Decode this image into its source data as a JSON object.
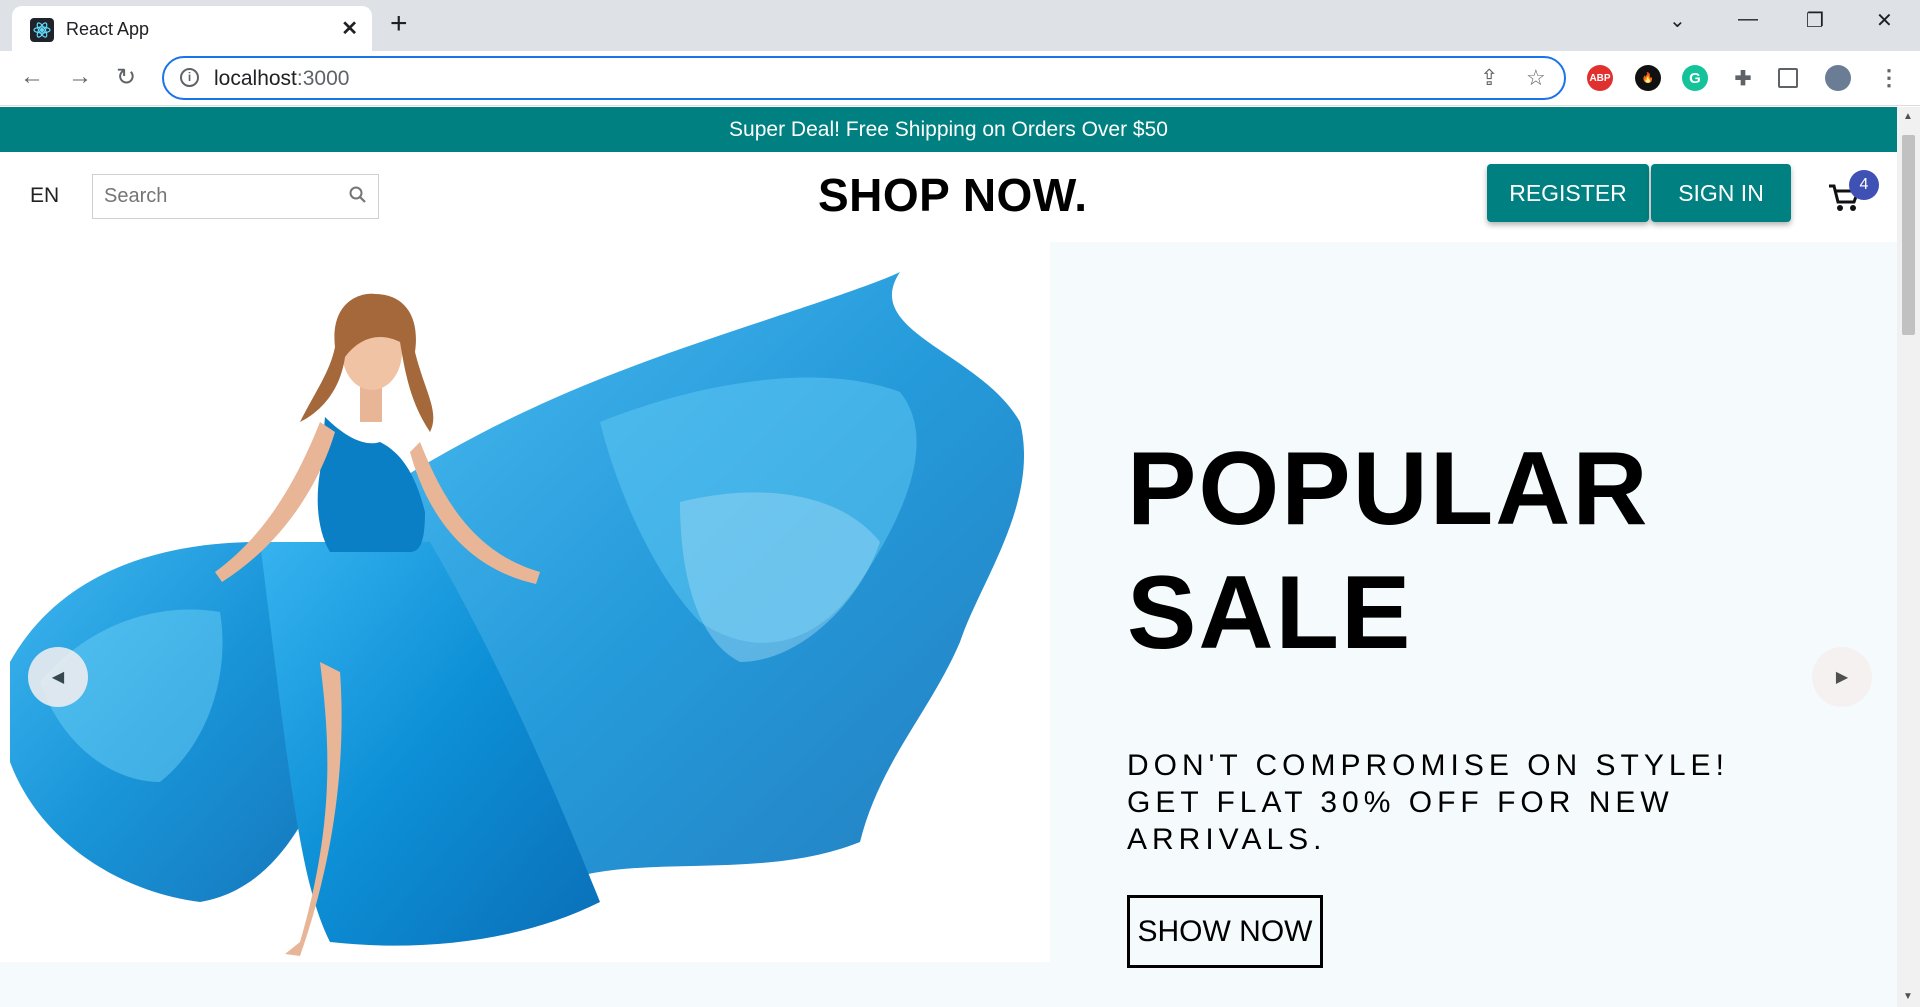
{
  "browser": {
    "tab_title": "React App",
    "url_host": "localhost",
    "url_port": ":3000",
    "ext_abp": "ABP",
    "ext_grammarly": "G"
  },
  "announcement": {
    "text": "Super Deal! Free Shipping on Orders Over $50"
  },
  "navbar": {
    "language": "EN",
    "search_placeholder": "Search",
    "logo": "SHOP NOW.",
    "register_label": "REGISTER",
    "signin_label": "SIGN IN",
    "cart_count": "4"
  },
  "hero": {
    "title": "POPULAR SALE",
    "description": "DON'T COMPROMISE ON STYLE! GET FLAT 30% OFF FOR NEW ARRIVALS.",
    "button_label": "SHOW NOW"
  },
  "colors": {
    "accent": "#008080",
    "badge": "#3f51b5",
    "dress": "#0d8fd6",
    "slide_bg": "#f5fafd"
  }
}
